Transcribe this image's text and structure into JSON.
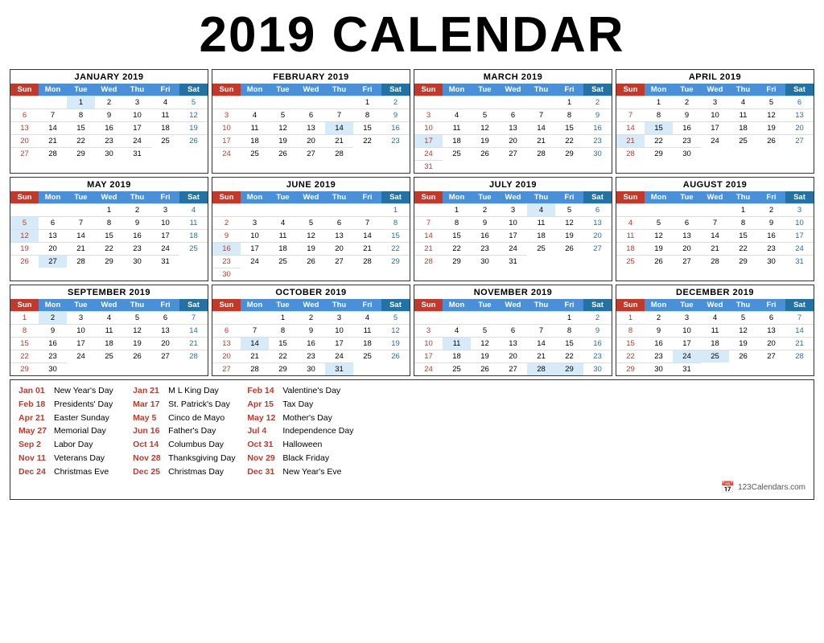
{
  "title": "2019 CALENDAR",
  "months": [
    {
      "name": "JANUARY 2019",
      "startDay": 2,
      "days": 31,
      "highlights": [
        1
      ]
    },
    {
      "name": "FEBRUARY 2019",
      "startDay": 5,
      "days": 28,
      "highlights": [
        14
      ]
    },
    {
      "name": "MARCH 2019",
      "startDay": 5,
      "days": 31,
      "highlights": [
        17
      ]
    },
    {
      "name": "APRIL 2019",
      "startDay": 1,
      "days": 30,
      "highlights": [
        15,
        21
      ]
    },
    {
      "name": "MAY 2019",
      "startDay": 3,
      "days": 31,
      "highlights": [
        5,
        12,
        27
      ]
    },
    {
      "name": "JUNE 2019",
      "startDay": 6,
      "days": 30,
      "highlights": [
        16
      ]
    },
    {
      "name": "JULY 2019",
      "startDay": 1,
      "days": 31,
      "highlights": [
        4
      ]
    },
    {
      "name": "AUGUST 2019",
      "startDay": 4,
      "days": 31,
      "highlights": []
    },
    {
      "name": "SEPTEMBER 2019",
      "startDay": 0,
      "days": 30,
      "highlights": [
        2
      ]
    },
    {
      "name": "OCTOBER 2019",
      "startDay": 2,
      "days": 31,
      "highlights": [
        14,
        31
      ]
    },
    {
      "name": "NOVEMBER 2019",
      "startDay": 5,
      "days": 30,
      "highlights": [
        11,
        28,
        29
      ]
    },
    {
      "name": "DECEMBER 2019",
      "startDay": 0,
      "days": 31,
      "highlights": [
        24,
        25
      ]
    }
  ],
  "dayHeaders": [
    "Sun",
    "Mon",
    "Tue",
    "Wed",
    "Thu",
    "Fri",
    "Sat"
  ],
  "holidays": {
    "col1": [
      {
        "date": "Jan 01",
        "name": "New Year's Day"
      },
      {
        "date": "Feb 18",
        "name": "Presidents' Day"
      },
      {
        "date": "Apr 21",
        "name": "Easter Sunday"
      },
      {
        "date": "May 27",
        "name": "Memorial Day"
      },
      {
        "date": "Sep 2",
        "name": "Labor Day"
      },
      {
        "date": "Nov 11",
        "name": "Veterans Day"
      },
      {
        "date": "Dec 24",
        "name": "Christmas Eve"
      }
    ],
    "col2": [
      {
        "date": "Jan 21",
        "name": "M L King Day"
      },
      {
        "date": "Mar 17",
        "name": "St. Patrick's Day"
      },
      {
        "date": "May 5",
        "name": "Cinco de Mayo"
      },
      {
        "date": "Jun 16",
        "name": "Father's Day"
      },
      {
        "date": "Oct 14",
        "name": "Columbus Day"
      },
      {
        "date": "Nov 28",
        "name": "Thanksgiving Day"
      },
      {
        "date": "Dec 25",
        "name": "Christmas Day"
      }
    ],
    "col3": [
      {
        "date": "Feb 14",
        "name": "Valentine's Day"
      },
      {
        "date": "Apr 15",
        "name": "Tax Day"
      },
      {
        "date": "May 12",
        "name": "Mother's Day"
      },
      {
        "date": "Jul 4",
        "name": "Independence Day"
      },
      {
        "date": "Oct 31",
        "name": "Halloween"
      },
      {
        "date": "Nov 29",
        "name": "Black Friday"
      },
      {
        "date": "Dec 31",
        "name": "New Year's Eve"
      }
    ]
  },
  "branding": "123Calendars.com"
}
